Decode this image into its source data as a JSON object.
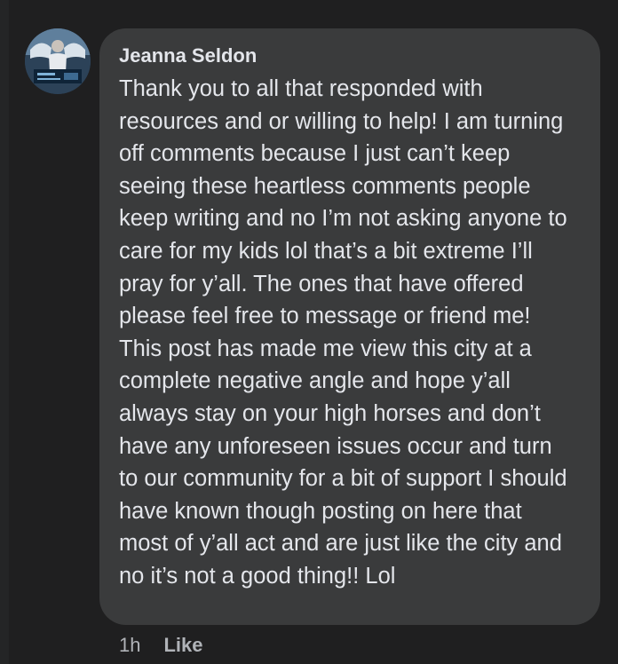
{
  "comment": {
    "author": "Jeanna Seldon",
    "text": "Thank you to all that responded with resources and or willing to help! I am turning off comments because I just can’t keep seeing these heartless comments people keep writing and no I’m not asking anyone to care for my kids lol that’s a bit extreme I’ll pray for y’all. The ones that have offered please feel free to message or friend me! This post has made me view this city at a complete negative angle and hope y’all always stay on your high horses and don’t have any unforeseen issues occur and turn to our community for a bit of support I should have known though posting on here that most of y’all act and are just like the city and no it’s not a good thing!! Lol",
    "timestamp": "1h",
    "like_label": "Like"
  },
  "colors": {
    "page_background": "#1f1f20",
    "bubble_background": "#3a3b3c",
    "primary_text": "#e4e6eb",
    "secondary_text": "#b0b3b8"
  }
}
